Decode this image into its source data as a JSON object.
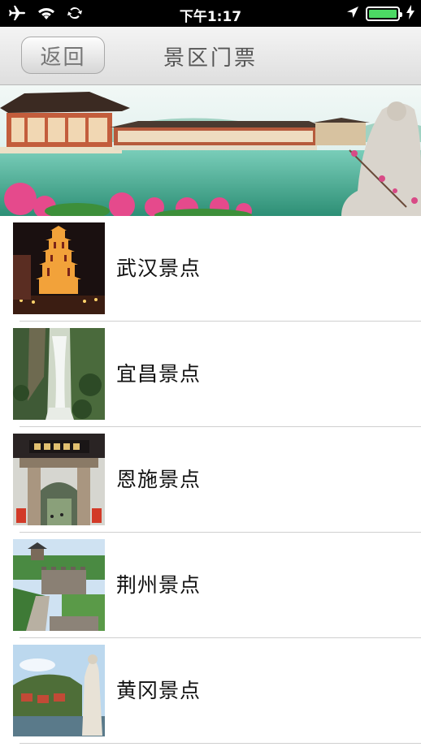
{
  "status_bar": {
    "time": "下午1:17",
    "icons": [
      "airplane-icon",
      "wifi-icon",
      "sync-icon",
      "location-arrow-icon",
      "battery-icon",
      "charging-icon"
    ],
    "battery_level": 1.0,
    "battery_color": "#4cd964"
  },
  "nav": {
    "back_label": "返回",
    "title": "景区门票"
  },
  "banner": {
    "image": "scenic-lake-pavilion-banner"
  },
  "list": {
    "items": [
      {
        "label": "武汉景点",
        "image": "yellow-crane-tower-night"
      },
      {
        "label": "宜昌景点",
        "image": "waterfall-cliff"
      },
      {
        "label": "恩施景点",
        "image": "enshi-gate"
      },
      {
        "label": "荆州景点",
        "image": "jingzhou-city-wall"
      },
      {
        "label": "黄冈景点",
        "image": "huanggang-statue-river"
      }
    ]
  }
}
